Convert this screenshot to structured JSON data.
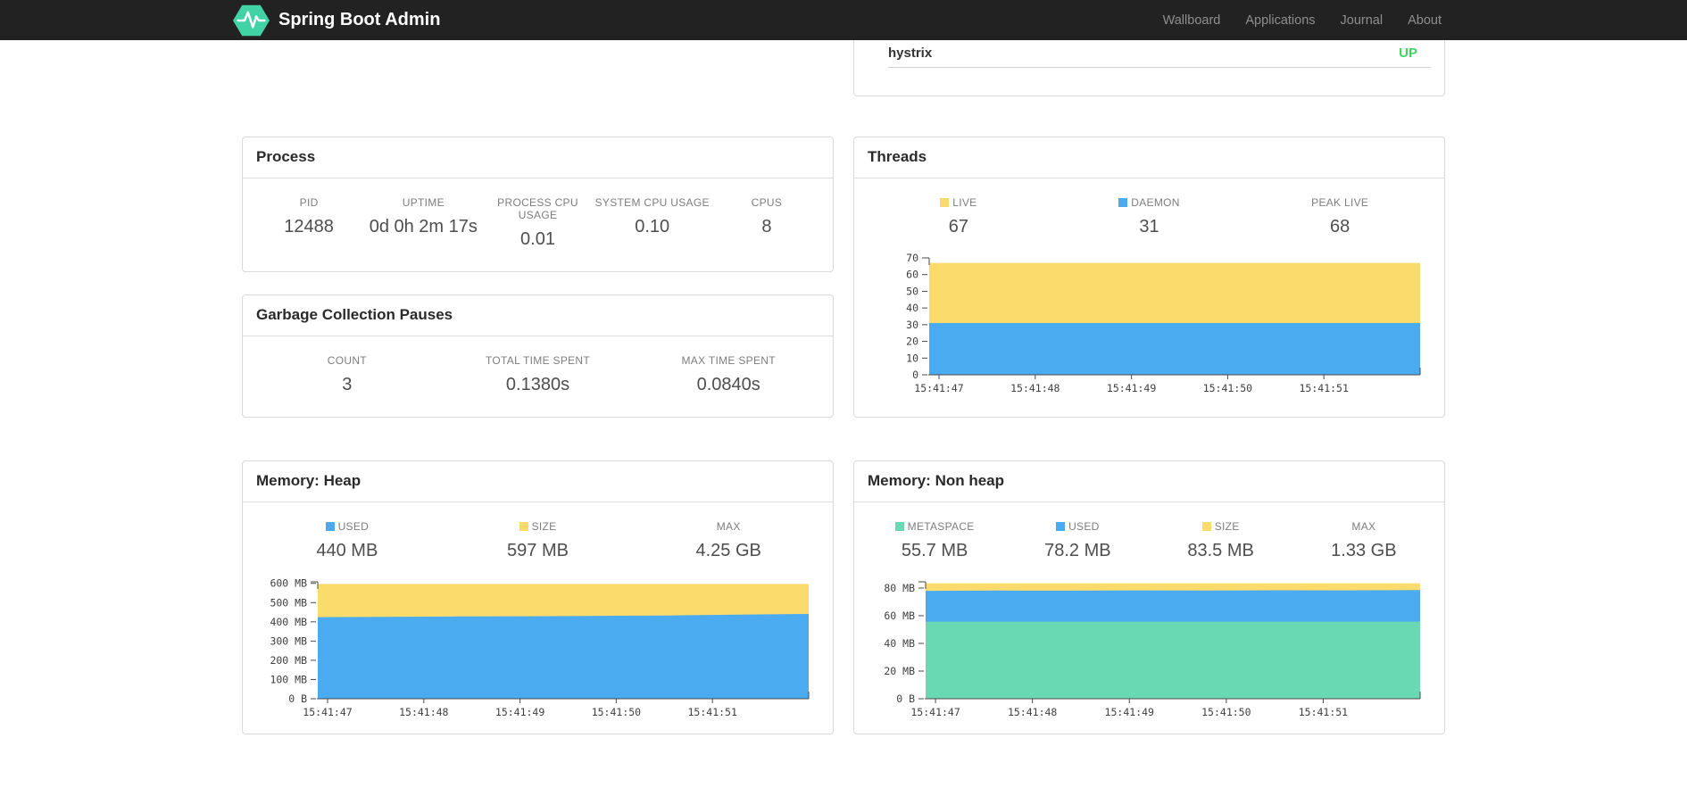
{
  "navbar": {
    "brand": "Spring Boot Admin",
    "links": [
      {
        "label": "Wallboard"
      },
      {
        "label": "Applications"
      },
      {
        "label": "Journal"
      },
      {
        "label": "About"
      }
    ]
  },
  "applications": {
    "rows": [
      {
        "name": "hystrix",
        "status": "UP"
      }
    ]
  },
  "cards": {
    "process": {
      "title": "Process",
      "stats": [
        {
          "label": "PID",
          "value": "12488"
        },
        {
          "label": "UPTIME",
          "value": "0d 0h 2m 17s"
        },
        {
          "label": "PROCESS CPU USAGE",
          "value": "0.01"
        },
        {
          "label": "SYSTEM CPU USAGE",
          "value": "0.10"
        },
        {
          "label": "CPUS",
          "value": "8"
        }
      ]
    },
    "gc": {
      "title": "Garbage Collection Pauses",
      "stats": [
        {
          "label": "COUNT",
          "value": "3"
        },
        {
          "label": "TOTAL TIME SPENT",
          "value": "0.1380s"
        },
        {
          "label": "MAX TIME SPENT",
          "value": "0.0840s"
        }
      ]
    },
    "threads": {
      "title": "Threads",
      "stats": [
        {
          "label": "LIVE",
          "value": "67",
          "swatch": "#fbdb6b"
        },
        {
          "label": "DAEMON",
          "value": "31",
          "swatch": "#4aabf1"
        },
        {
          "label": "PEAK LIVE",
          "value": "68"
        }
      ]
    },
    "heap": {
      "title": "Memory: Heap",
      "stats": [
        {
          "label": "USED",
          "value": "440 MB",
          "swatch": "#4aabf1"
        },
        {
          "label": "SIZE",
          "value": "597 MB",
          "swatch": "#fbdb6b"
        },
        {
          "label": "MAX",
          "value": "4.25 GB"
        }
      ]
    },
    "nonheap": {
      "title": "Memory: Non heap",
      "stats": [
        {
          "label": "METASPACE",
          "value": "55.7 MB",
          "swatch": "#68d9b2"
        },
        {
          "label": "USED",
          "value": "78.2 MB",
          "swatch": "#4aabf1"
        },
        {
          "label": "SIZE",
          "value": "83.5 MB",
          "swatch": "#fbdb6b"
        },
        {
          "label": "MAX",
          "value": "1.33 GB"
        }
      ]
    }
  },
  "colors": {
    "navbar_bg": "#222222",
    "nav_link": "#8f8f8f",
    "logo_green": "#42d3a5",
    "status_up": "#42d35f",
    "chart_yellow": "#fbdb6b",
    "chart_blue": "#4aabf1",
    "chart_green": "#68d9b2",
    "card_border": "#d9d9d9"
  },
  "chart_data": [
    {
      "id": "threads",
      "type": "area",
      "title": "Threads",
      "draw_order": "back-to-front",
      "x_labels": [
        "15:41:47",
        "15:41:48",
        "15:41:49",
        "15:41:50",
        "15:41:51"
      ],
      "ylim": [
        0,
        70
      ],
      "yticks": [
        {
          "v": 0,
          "label": "0"
        },
        {
          "v": 10,
          "label": "10"
        },
        {
          "v": 20,
          "label": "20"
        },
        {
          "v": 30,
          "label": "30"
        },
        {
          "v": 40,
          "label": "40"
        },
        {
          "v": 50,
          "label": "50"
        },
        {
          "v": 60,
          "label": "60"
        },
        {
          "v": 70,
          "label": "70"
        }
      ],
      "series": [
        {
          "name": "LIVE",
          "color": "#fbdb6b",
          "values": [
            67,
            67,
            67,
            67,
            67,
            67,
            67,
            67
          ]
        },
        {
          "name": "DAEMON",
          "color": "#4aabf1",
          "values": [
            31,
            31,
            31,
            31,
            31,
            31,
            31,
            31
          ]
        }
      ]
    },
    {
      "id": "heap",
      "type": "area",
      "title": "Memory: Heap",
      "draw_order": "back-to-front",
      "x_labels": [
        "15:41:47",
        "15:41:48",
        "15:41:49",
        "15:41:50",
        "15:41:51"
      ],
      "ylim": [
        0,
        608
      ],
      "yticks": [
        {
          "v": 0,
          "label": "0 B"
        },
        {
          "v": 100,
          "label": "100 MB"
        },
        {
          "v": 200,
          "label": "200 MB"
        },
        {
          "v": 300,
          "label": "300 MB"
        },
        {
          "v": 400,
          "label": "400 MB"
        },
        {
          "v": 500,
          "label": "500 MB"
        },
        {
          "v": 600,
          "label": "600 MB"
        }
      ],
      "series": [
        {
          "name": "SIZE",
          "color": "#fbdb6b",
          "values": [
            597,
            597,
            597,
            597,
            597,
            597,
            597,
            597
          ]
        },
        {
          "name": "USED",
          "color": "#4aabf1",
          "values": [
            424,
            426,
            428,
            429,
            431,
            433,
            437,
            441
          ]
        }
      ]
    },
    {
      "id": "nonheap",
      "type": "area",
      "title": "Memory: Non heap",
      "draw_order": "back-to-front",
      "x_labels": [
        "15:41:47",
        "15:41:48",
        "15:41:49",
        "15:41:50",
        "15:41:51"
      ],
      "ylim": [
        0,
        84.5
      ],
      "yticks": [
        {
          "v": 0,
          "label": "0 B"
        },
        {
          "v": 20,
          "label": "20 MB"
        },
        {
          "v": 40,
          "label": "40 MB"
        },
        {
          "v": 60,
          "label": "60 MB"
        },
        {
          "v": 80,
          "label": "80 MB"
        }
      ],
      "series": [
        {
          "name": "SIZE",
          "color": "#fbdb6b",
          "values": [
            83.5,
            83.5,
            83.5,
            83.5,
            83.5,
            83.5,
            83.5,
            83.5
          ]
        },
        {
          "name": "USED",
          "color": "#4aabf1",
          "values": [
            78,
            78.2,
            78.1,
            78.3,
            78.2,
            78.4,
            78.3,
            78.5
          ]
        },
        {
          "name": "METASPACE",
          "color": "#68d9b2",
          "values": [
            55.7,
            55.7,
            55.7,
            55.7,
            55.7,
            55.7,
            55.7,
            55.7
          ]
        }
      ]
    }
  ]
}
